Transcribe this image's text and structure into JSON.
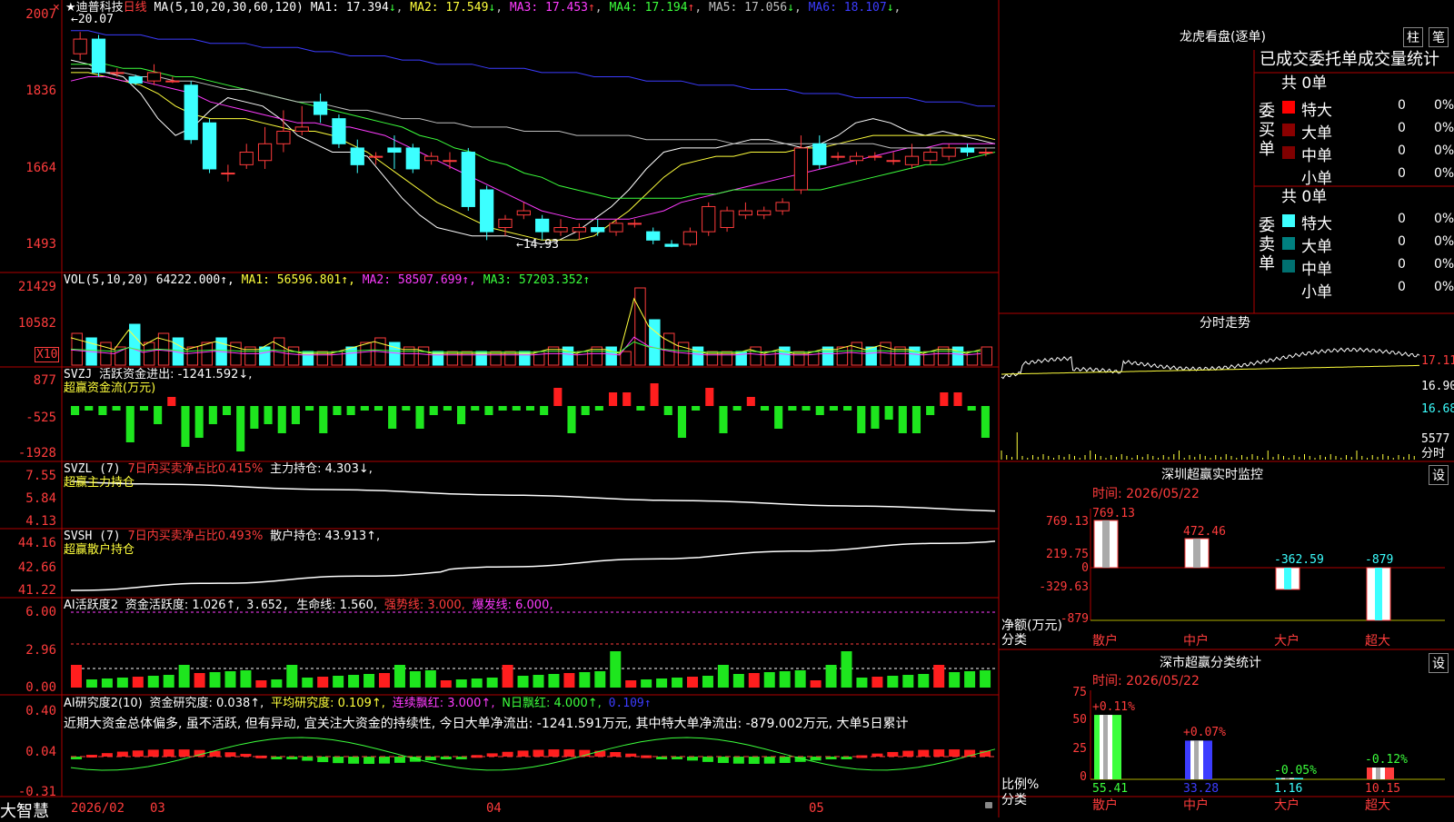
{
  "stock": {
    "star": "★",
    "name": "迪普科技",
    "period": "日线",
    "brand": "大智慧"
  },
  "main_panel": {
    "ma_header": "MA(5,10,20,30,60,120)",
    "ma": [
      {
        "label": "MA1: 17.394",
        "arrow": "↓",
        "color": "#ffffff"
      },
      {
        "label": "MA2: 17.549",
        "arrow": "↓",
        "color": "#ffff3c"
      },
      {
        "label": "MA3: 17.453",
        "arrow": "↑",
        "color": "#ff3cff"
      },
      {
        "label": "MA4: 17.194",
        "arrow": "↑",
        "color": "#3cff3c"
      },
      {
        "label": "MA5: 17.056",
        "arrow": "↓",
        "color": "#c0c0c0"
      },
      {
        "label": "MA6: 18.107",
        "arrow": "↓",
        "color": "#3c3cff"
      }
    ],
    "y_labels": [
      "2007",
      "1836",
      "1664",
      "1493"
    ],
    "high_mark": "20.07",
    "low_mark": "←14.93",
    "price_min": 14.5,
    "price_max": 20.4,
    "ma5_series": [
      19.4,
      19.3,
      19.1,
      19.0,
      18.6,
      18.0,
      17.6,
      17.8,
      18.2,
      18.5,
      18.4,
      18.3,
      18.0,
      17.6,
      17.4,
      17.2,
      17.2,
      17.1,
      16.6,
      16.1,
      15.7,
      15.4,
      15.3,
      15.2,
      15.2,
      15.2,
      15.1,
      15.0,
      15.1,
      15.3,
      15.6,
      15.9,
      16.3,
      16.8,
      17.2,
      17.3,
      17.3,
      17.3,
      17.4,
      17.5,
      17.5,
      17.4,
      17.3,
      17.4,
      17.6,
      17.9,
      18.0,
      17.9,
      17.7,
      17.6,
      17.7,
      17.6,
      17.5,
      17.4
    ],
    "ma10_series": [
      19.1,
      19.1,
      19.0,
      18.9,
      18.8,
      18.6,
      18.3,
      18.1,
      18.0,
      18.0,
      18.0,
      17.9,
      17.8,
      17.7,
      17.7,
      17.6,
      17.4,
      17.2,
      16.9,
      16.6,
      16.3,
      16.0,
      15.8,
      15.6,
      15.4,
      15.3,
      15.2,
      15.1,
      15.1,
      15.1,
      15.2,
      15.5,
      15.8,
      16.2,
      16.6,
      16.9,
      17.0,
      17.1,
      17.1,
      17.2,
      17.2,
      17.2,
      17.3,
      17.3,
      17.4,
      17.5,
      17.6,
      17.6,
      17.6,
      17.6,
      17.6,
      17.6,
      17.6,
      17.5
    ],
    "ma20_series": [
      18.9,
      19.0,
      19.0,
      18.9,
      18.9,
      18.8,
      18.7,
      18.6,
      18.4,
      18.3,
      18.2,
      18.1,
      18.0,
      17.9,
      17.9,
      17.8,
      17.8,
      17.7,
      17.6,
      17.4,
      17.2,
      17.0,
      16.8,
      16.6,
      16.4,
      16.2,
      16.0,
      15.8,
      15.7,
      15.6,
      15.6,
      15.6,
      15.6,
      15.7,
      15.8,
      16.0,
      16.1,
      16.2,
      16.3,
      16.4,
      16.5,
      16.6,
      16.7,
      16.8,
      16.9,
      17.0,
      17.1,
      17.2,
      17.3,
      17.3,
      17.4,
      17.4,
      17.4,
      17.4
    ],
    "ma30_series": [
      19.3,
      19.3,
      19.3,
      19.2,
      19.2,
      19.1,
      19.0,
      19.0,
      18.9,
      18.8,
      18.7,
      18.6,
      18.5,
      18.4,
      18.3,
      18.2,
      18.1,
      18.0,
      17.9,
      17.8,
      17.6,
      17.5,
      17.3,
      17.2,
      17.0,
      16.9,
      16.7,
      16.6,
      16.4,
      16.3,
      16.2,
      16.1,
      16.1,
      16.1,
      16.1,
      16.1,
      16.2,
      16.2,
      16.3,
      16.3,
      16.3,
      16.3,
      16.3,
      16.3,
      16.4,
      16.5,
      16.6,
      16.7,
      16.8,
      16.9,
      16.9,
      17.0,
      17.1,
      17.2
    ],
    "ma60_series": [
      19.2,
      19.2,
      19.1,
      19.1,
      19.0,
      19.0,
      18.9,
      18.9,
      18.8,
      18.7,
      18.7,
      18.6,
      18.5,
      18.4,
      18.4,
      18.3,
      18.2,
      18.2,
      18.1,
      18.0,
      18.0,
      17.9,
      17.9,
      17.8,
      17.8,
      17.8,
      17.7,
      17.7,
      17.7,
      17.6,
      17.6,
      17.6,
      17.6,
      17.5,
      17.5,
      17.5,
      17.5,
      17.5,
      17.4,
      17.4,
      17.4,
      17.4,
      17.4,
      17.4,
      17.4,
      17.4,
      17.4,
      17.3,
      17.3,
      17.3,
      17.3,
      17.3,
      17.3,
      17.3
    ],
    "ma120_series": [
      20.1,
      20.1,
      20.0,
      20.0,
      20.0,
      19.9,
      19.9,
      19.9,
      19.8,
      19.8,
      19.8,
      19.7,
      19.7,
      19.7,
      19.6,
      19.6,
      19.5,
      19.5,
      19.5,
      19.4,
      19.4,
      19.3,
      19.3,
      19.3,
      19.2,
      19.2,
      19.2,
      19.1,
      19.1,
      19.1,
      19.0,
      19.0,
      19.0,
      18.9,
      18.9,
      18.9,
      18.8,
      18.8,
      18.8,
      18.7,
      18.7,
      18.7,
      18.6,
      18.6,
      18.6,
      18.5,
      18.5,
      18.5,
      18.5,
      18.4,
      18.4,
      18.4,
      18.3,
      18.3
    ]
  },
  "candles": [
    {
      "o": 19.55,
      "c": 19.9,
      "h": 20.07,
      "l": 19.4
    },
    {
      "o": 19.9,
      "c": 19.1,
      "h": 20.0,
      "l": 19.0
    },
    {
      "o": 19.1,
      "c": 19.1,
      "h": 19.2,
      "l": 19.0
    },
    {
      "o": 19.0,
      "c": 18.85,
      "h": 19.05,
      "l": 18.8
    },
    {
      "o": 18.9,
      "c": 19.1,
      "h": 19.3,
      "l": 18.8
    },
    {
      "o": 18.9,
      "c": 18.9,
      "h": 19.0,
      "l": 18.85
    },
    {
      "o": 18.8,
      "c": 17.5,
      "h": 18.9,
      "l": 17.4
    },
    {
      "o": 17.9,
      "c": 16.8,
      "h": 18.0,
      "l": 16.7
    },
    {
      "o": 16.7,
      "c": 16.7,
      "h": 16.9,
      "l": 16.5
    },
    {
      "o": 16.9,
      "c": 17.2,
      "h": 17.4,
      "l": 16.8
    },
    {
      "o": 17.0,
      "c": 17.4,
      "h": 17.8,
      "l": 16.8
    },
    {
      "o": 17.4,
      "c": 17.7,
      "h": 18.2,
      "l": 17.2
    },
    {
      "o": 17.7,
      "c": 17.8,
      "h": 18.3,
      "l": 17.6
    },
    {
      "o": 18.4,
      "c": 18.1,
      "h": 18.6,
      "l": 17.9
    },
    {
      "o": 18.0,
      "c": 17.4,
      "h": 18.1,
      "l": 17.3
    },
    {
      "o": 17.3,
      "c": 16.9,
      "h": 17.5,
      "l": 16.7
    },
    {
      "o": 17.1,
      "c": 17.1,
      "h": 17.2,
      "l": 16.9
    },
    {
      "o": 17.3,
      "c": 17.2,
      "h": 17.6,
      "l": 16.8
    },
    {
      "o": 17.3,
      "c": 16.8,
      "h": 17.4,
      "l": 16.7
    },
    {
      "o": 17.0,
      "c": 17.1,
      "h": 17.2,
      "l": 16.9
    },
    {
      "o": 17.0,
      "c": 17.0,
      "h": 17.2,
      "l": 16.8
    },
    {
      "o": 17.2,
      "c": 15.9,
      "h": 17.3,
      "l": 15.8
    },
    {
      "o": 16.3,
      "c": 15.3,
      "h": 16.4,
      "l": 15.1
    },
    {
      "o": 15.4,
      "c": 15.6,
      "h": 15.7,
      "l": 15.2
    },
    {
      "o": 15.7,
      "c": 15.8,
      "h": 16.0,
      "l": 15.6
    },
    {
      "o": 15.6,
      "c": 15.3,
      "h": 15.7,
      "l": 15.1
    },
    {
      "o": 15.3,
      "c": 15.4,
      "h": 15.6,
      "l": 15.2
    },
    {
      "o": 15.3,
      "c": 15.4,
      "h": 15.5,
      "l": 15.1
    },
    {
      "o": 15.4,
      "c": 15.3,
      "h": 15.6,
      "l": 15.2
    },
    {
      "o": 15.3,
      "c": 15.5,
      "h": 15.6,
      "l": 15.2
    },
    {
      "o": 15.5,
      "c": 15.5,
      "h": 15.6,
      "l": 15.4
    },
    {
      "o": 15.3,
      "c": 15.1,
      "h": 15.4,
      "l": 15.0
    },
    {
      "o": 15.0,
      "c": 14.95,
      "h": 15.1,
      "l": 14.93
    },
    {
      "o": 15.0,
      "c": 15.3,
      "h": 15.4,
      "l": 14.95
    },
    {
      "o": 15.3,
      "c": 15.9,
      "h": 16.0,
      "l": 15.2
    },
    {
      "o": 15.4,
      "c": 15.8,
      "h": 15.9,
      "l": 15.3
    },
    {
      "o": 15.7,
      "c": 15.8,
      "h": 16.0,
      "l": 15.6
    },
    {
      "o": 15.7,
      "c": 15.8,
      "h": 15.9,
      "l": 15.6
    },
    {
      "o": 15.8,
      "c": 16.0,
      "h": 16.1,
      "l": 15.7
    },
    {
      "o": 16.3,
      "c": 17.3,
      "h": 17.6,
      "l": 16.2
    },
    {
      "o": 17.4,
      "c": 16.9,
      "h": 17.6,
      "l": 16.8
    },
    {
      "o": 17.1,
      "c": 17.1,
      "h": 17.2,
      "l": 17.0
    },
    {
      "o": 17.0,
      "c": 17.1,
      "h": 17.2,
      "l": 16.9
    },
    {
      "o": 17.1,
      "c": 17.1,
      "h": 17.2,
      "l": 17.0
    },
    {
      "o": 17.0,
      "c": 17.0,
      "h": 17.2,
      "l": 16.9
    },
    {
      "o": 16.9,
      "c": 17.1,
      "h": 17.4,
      "l": 16.8
    },
    {
      "o": 17.0,
      "c": 17.2,
      "h": 17.3,
      "l": 16.9
    },
    {
      "o": 17.1,
      "c": 17.3,
      "h": 17.4,
      "l": 17.0
    },
    {
      "o": 17.3,
      "c": 17.2,
      "h": 17.4,
      "l": 17.1
    },
    {
      "o": 17.2,
      "c": 17.2,
      "h": 17.3,
      "l": 17.1
    }
  ],
  "vol_panel": {
    "header": "VOL(5,10,20)",
    "value": "64222.000↑,",
    "ma": [
      {
        "label": "MA1: 56596.801↑,",
        "color": "#ffff3c"
      },
      {
        "label": "MA2: 58507.699↑,",
        "color": "#ff3cff"
      },
      {
        "label": "MA3: 57203.352↑",
        "color": "#3cff3c"
      }
    ],
    "y_labels": [
      "21429",
      "10582"
    ],
    "unit": "X10",
    "bars": [
      7,
      6,
      5,
      4,
      9,
      5,
      7,
      6,
      4,
      5,
      6,
      5,
      4,
      4,
      6,
      4,
      3,
      3,
      3,
      4,
      5,
      6,
      5,
      4,
      4,
      3,
      3,
      3,
      3,
      3,
      3,
      3,
      3,
      4,
      4,
      3,
      4,
      4,
      3,
      17,
      10,
      7,
      5,
      4,
      3,
      3,
      3,
      4,
      3,
      4,
      3,
      3,
      4,
      4,
      5,
      4,
      5,
      4,
      4,
      3,
      4,
      4,
      3,
      4
    ]
  },
  "svzj_panel": {
    "header": "SVZJ",
    "text1": "活跃资金进出: -1241.592↓,",
    "text2": "超赢资金流(万元)",
    "y_labels": [
      "877",
      "-525",
      "-1928"
    ],
    "bars": [
      -2,
      -1,
      -2,
      -1,
      -8,
      -1,
      -4,
      2,
      -9,
      -7,
      -4,
      -2,
      -10,
      -5,
      -4,
      -6,
      -4,
      -1,
      -6,
      -2,
      -2,
      -1,
      -1,
      -5,
      -1,
      -5,
      -2,
      -1,
      -4,
      -1,
      -2,
      -1,
      -1,
      -1,
      -2,
      4,
      -6,
      -2,
      -1,
      3,
      3,
      -1,
      5,
      -2,
      -7,
      -1,
      4,
      -6,
      -1,
      2,
      -1,
      -5,
      -1,
      -1,
      -2,
      -1,
      -1,
      -6,
      -5,
      -3,
      -6,
      -6,
      -2,
      3,
      3,
      -1,
      -7
    ]
  },
  "svzl_panel": {
    "header": "SVZL (7)",
    "text1": "7日内买卖净占比0.415%",
    "text2": "主力持仓: 4.303↓,",
    "text3": "超赢主力持仓",
    "y_labels": [
      "7.55",
      "5.84",
      "4.13"
    ]
  },
  "svsh_panel": {
    "header": "SVSH (7)",
    "text1": "7日内买卖净占比0.493%",
    "text2": "散户持仓: 43.913↑,",
    "text3": "超赢散户持仓",
    "y_labels": [
      "44.16",
      "42.66",
      "41.22"
    ]
  },
  "ai_active_panel": {
    "header": "AI活跃度2",
    "text1": "资金活跃度: 1.026↑,",
    "text2": "3.652,",
    "text3": "生命线: 1.560,",
    "text4": "强势线: 3.000,",
    "text5": "爆发线: 6.000,",
    "y_labels": [
      "6.00",
      "2.96",
      "0.00"
    ]
  },
  "ai_research_panel": {
    "header": "AI研究度2(10)",
    "text1": "资金研究度: 0.038↑,",
    "text2": "平均研究度: 0.109↑,",
    "text3": "连续飘红: 3.000↑,",
    "text4": "N日飘红: 4.000↑,",
    "text5": "0.109↑",
    "comment": "近期大资金总体偏多, 虽不活跃, 但有异动, 宜关注大资金的持续性, 今日大单净流出: -1241.591万元, 其中特大单净流出: -879.002万元, 大单5日累计",
    "y_labels": [
      "0.40",
      "0.04",
      "-0.31"
    ]
  },
  "x_axis": {
    "labels": [
      "2026/02",
      "03",
      "04",
      "05"
    ]
  },
  "right_top": {
    "title": "龙虎看盘(逐单)",
    "btn1": "柱",
    "btn2": "笔",
    "section_title": "已成交委托单成交量统计",
    "buy_label": "委买单",
    "sell_label": "委卖单",
    "buy_total": "共 0单",
    "sell_total": "共 0单",
    "buy_rows": [
      {
        "name": "特大",
        "v1": "0",
        "v2": "0%",
        "color": "#ff0000"
      },
      {
        "name": "大单",
        "v1": "0",
        "v2": "0%",
        "color": "#8b0000"
      },
      {
        "name": "中单",
        "v1": "0",
        "v2": "0%",
        "color": "#800000"
      },
      {
        "name": "小单",
        "v1": "0",
        "v2": "0%",
        "color": "#000000"
      }
    ],
    "sell_rows": [
      {
        "name": "特大",
        "v1": "0",
        "v2": "0%",
        "color": "#3cffff"
      },
      {
        "name": "大单",
        "v1": "0",
        "v2": "0%",
        "color": "#008080"
      },
      {
        "name": "中单",
        "v1": "0",
        "v2": "0%",
        "color": "#007070"
      },
      {
        "name": "小单",
        "v1": "0",
        "v2": "0%",
        "color": "#000000"
      }
    ]
  },
  "intraday": {
    "title": "分时走势",
    "y_labels": [
      "17.11",
      "16.90",
      "16.68"
    ],
    "vol_label": "5577",
    "unit": "分时"
  },
  "shenzhen_monitor": {
    "title": "深圳超赢实时监控",
    "btn": "设",
    "time": "时间: 2026/05/22",
    "y_labels": [
      "769.13",
      "219.75",
      "0",
      "-329.63",
      "-879"
    ],
    "unit1": "净额(万元)",
    "unit2": "分类",
    "bars": [
      {
        "cat": "散户",
        "value": 769.13,
        "label": "769.13"
      },
      {
        "cat": "中户",
        "value": 472.46,
        "label": "472.46"
      },
      {
        "cat": "大户",
        "value": -362.59,
        "label": "-362.59"
      },
      {
        "cat": "超大",
        "value": -879,
        "label": "-879"
      }
    ]
  },
  "shenzhen_class": {
    "title": "深市超赢分类统计",
    "btn": "设",
    "time": "时间: 2026/05/22",
    "y_labels": [
      "75",
      "50",
      "25",
      "0"
    ],
    "unit1": "比例%",
    "unit2": "分类",
    "bars": [
      {
        "cat": "散户",
        "value": 55.41,
        "label": "55.41",
        "change": "+0.11%",
        "color": "#3cff3c"
      },
      {
        "cat": "中户",
        "value": 33.28,
        "label": "33.28",
        "change": "+0.07%",
        "color": "#3c3cff"
      },
      {
        "cat": "大户",
        "value": 1.16,
        "label": "1.16",
        "change": "-0.05%",
        "color": "#3cffff"
      },
      {
        "cat": "超大",
        "value": 10.15,
        "label": "10.15",
        "change": "-0.12%",
        "color": "#ff3c3c"
      }
    ]
  }
}
